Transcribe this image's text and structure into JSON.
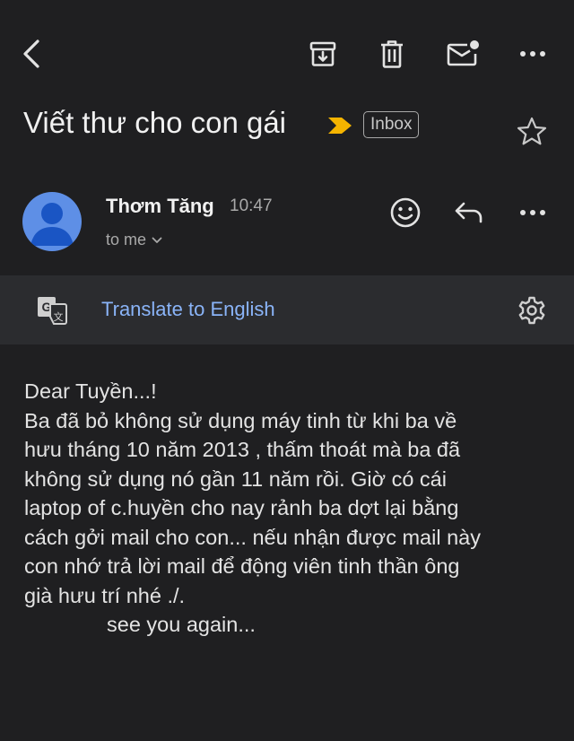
{
  "toolbar": {
    "back_icon": "arrow-left-icon",
    "archive_icon": "archive-icon",
    "delete_icon": "trash-icon",
    "mark_unread_icon": "mail-unread-icon",
    "more_icon": "more-horizontal-icon"
  },
  "email": {
    "subject": "Viết thư cho con gái",
    "label": "Inbox",
    "sender_name": "Thơm Tăng",
    "time": "10:47",
    "recipient": "to me"
  },
  "translate": {
    "link_text": "Translate to English"
  },
  "body": {
    "lines": [
      "Dear Tuyền...!",
      "Ba đã bỏ không sử dụng máy tinh từ khi ba về",
      "hưu tháng 10 năm 2013 , thấm thoát mà ba đã",
      "không sử dụng nó gần 11 năm rồi. Giờ có cái",
      "laptop of c.huyền cho nay rảnh ba dợt lại bằng",
      "cách gởi mail cho con... nếu nhận được mail này",
      "con nhớ trả lời mail để động viên tinh thần ông",
      "già hưu trí nhé ./."
    ],
    "signoff": "see you again..."
  },
  "colors": {
    "background": "#1f1f21",
    "translate_bar": "#2b2c2f",
    "link": "#8ab4f8",
    "importance": "#f5b400",
    "avatar": "#5e8fe6"
  }
}
